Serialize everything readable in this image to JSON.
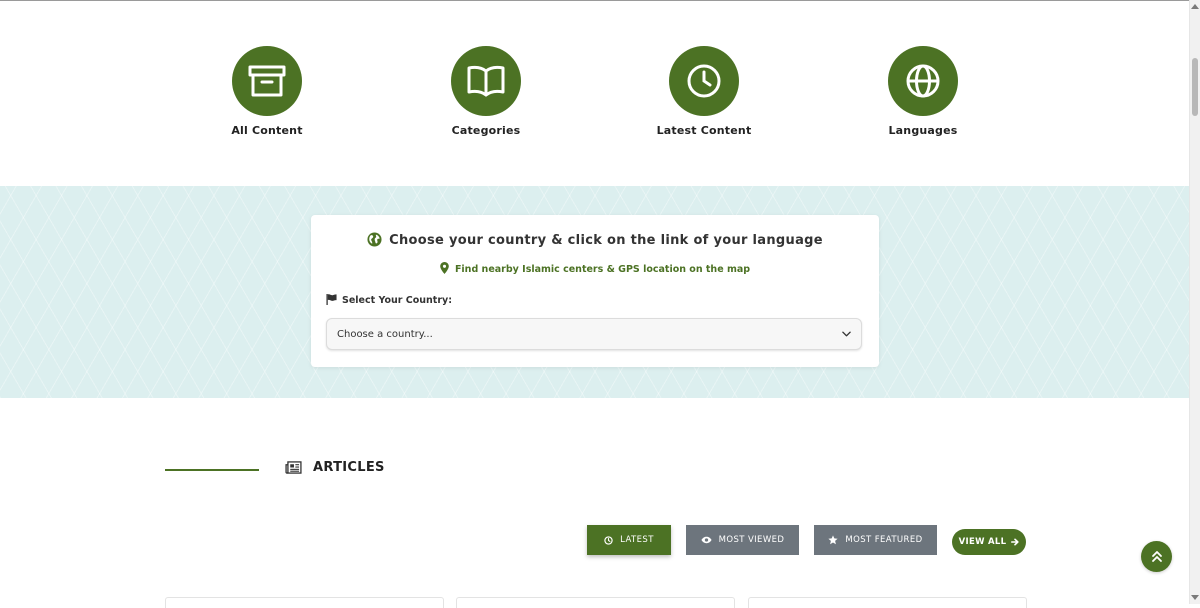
{
  "quick_nav": {
    "items": [
      {
        "label": "All Content",
        "icon": "archive-icon"
      },
      {
        "label": "Categories",
        "icon": "book-open-icon"
      },
      {
        "label": "Latest Content",
        "icon": "clock-icon"
      },
      {
        "label": "Languages",
        "icon": "globe-icon"
      }
    ]
  },
  "country_selector": {
    "title": "Choose your country & click on the link of your language",
    "gps_link": "Find nearby Islamic centers & GPS location on the map",
    "select_label": "Select Your Country:",
    "select_value": "Choose a country..."
  },
  "articles": {
    "heading": "ARTICLES",
    "tabs": {
      "latest": "LATEST",
      "most_viewed": "MOST VIEWED",
      "most_featured": "MOST FEATURED"
    },
    "view_all": "VIEW ALL"
  },
  "colors": {
    "accent": "#4c7224",
    "tab_inactive": "#6d757d",
    "band_bg": "#dcefef"
  }
}
